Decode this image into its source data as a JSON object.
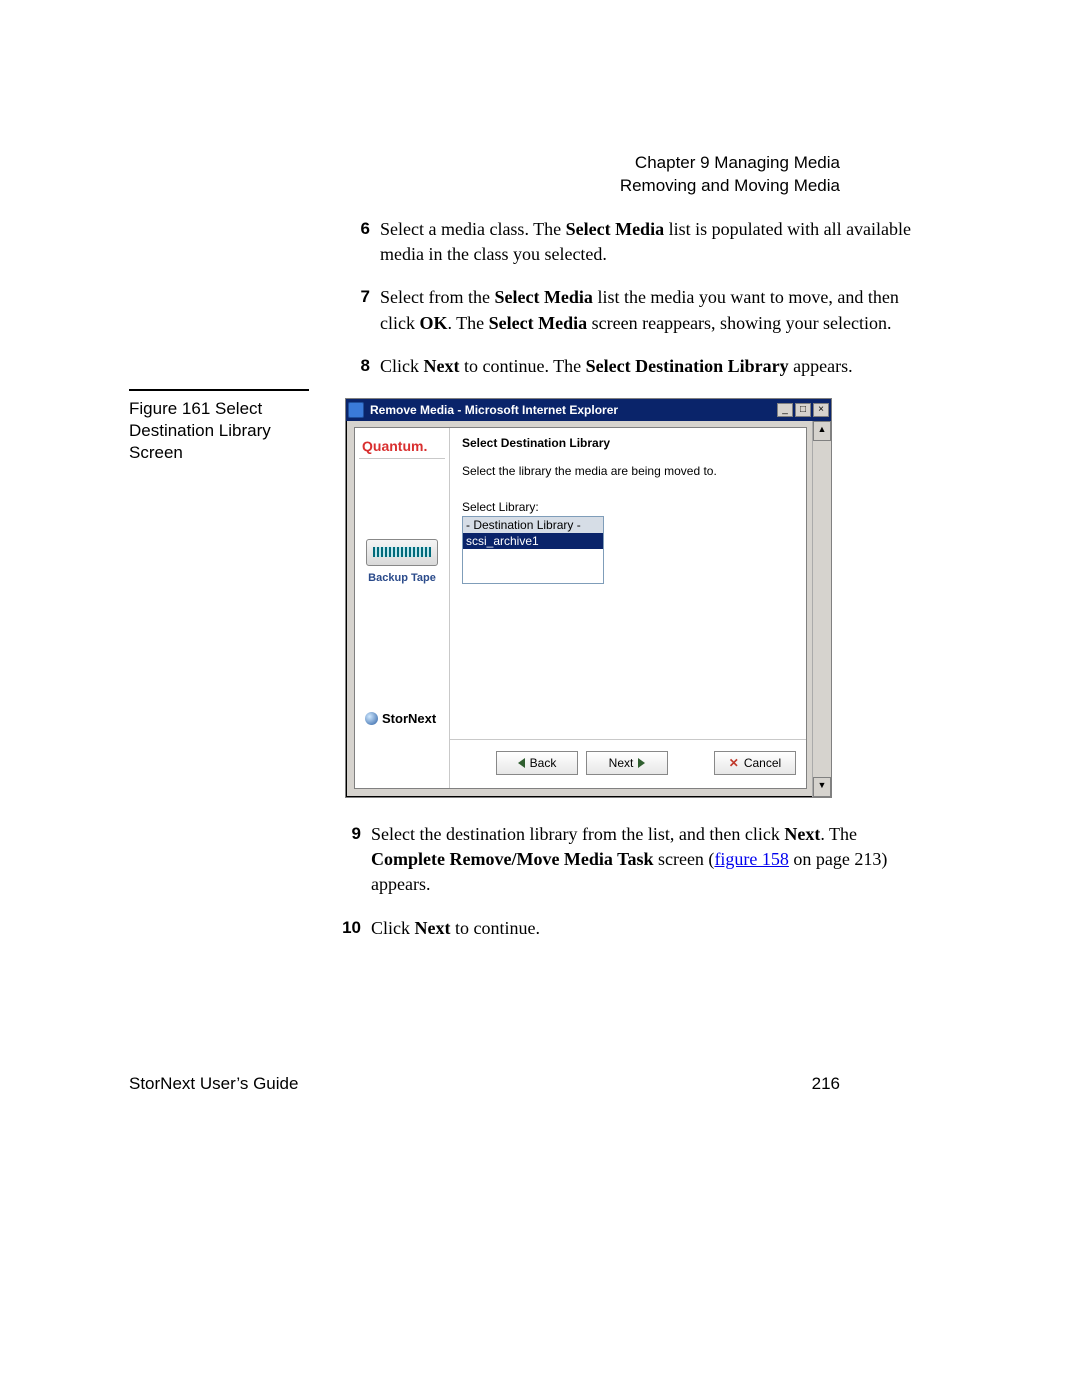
{
  "header": {
    "chapter": "Chapter 9  Managing Media",
    "section": "Removing and Moving Media"
  },
  "steps": [
    {
      "num": "6",
      "b1": "Select Media"
    },
    {
      "num": "7",
      "b1": "Select Media",
      "b2": "OK",
      "b3": "Select Media"
    },
    {
      "num": "8",
      "b1": "Next",
      "b2": "Select Destination Library"
    },
    {
      "num": "9",
      "b1": "Next",
      "b2": "Complete Remove/Move Media Task",
      "link": "figure 158"
    },
    {
      "num": "10",
      "b1": "Next"
    }
  ],
  "figure": {
    "caption": "Figure 161  Select Destination Library Screen"
  },
  "screenshot": {
    "windowTitle": "Remove Media - Microsoft Internet Explorer",
    "brand": "Quantum.",
    "sideLabel": "Backup Tape",
    "stornext": "StorNext",
    "heading": "Select Destination Library",
    "instruction": "Select the library the media are being moved to.",
    "listLabel": "Select Library:",
    "listHeader": "- Destination Library -",
    "listSelected": "scsi_archive1",
    "buttons": {
      "back": "Back",
      "next": "Next",
      "cancel": "Cancel"
    }
  },
  "footer": {
    "guide": "StorNext User’s Guide",
    "page": "216"
  }
}
